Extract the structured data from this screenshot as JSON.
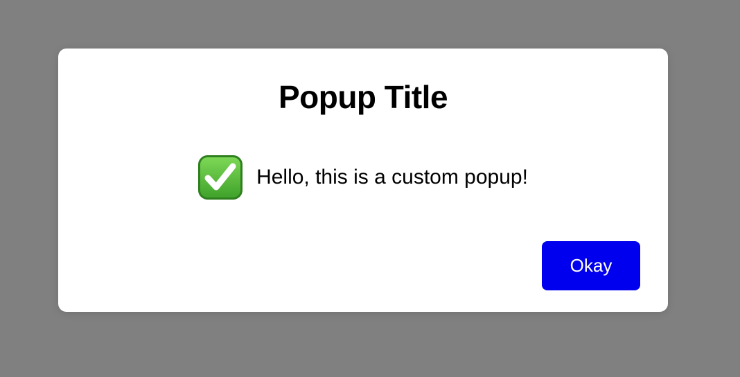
{
  "page": {
    "overlay_color": "#808080"
  },
  "popup": {
    "title": "Popup Title",
    "message": "Hello, this is a custom popup!",
    "message_icon": "green-check-mark-icon",
    "accent_color": "#0000ee",
    "okay_label": "Okay"
  }
}
